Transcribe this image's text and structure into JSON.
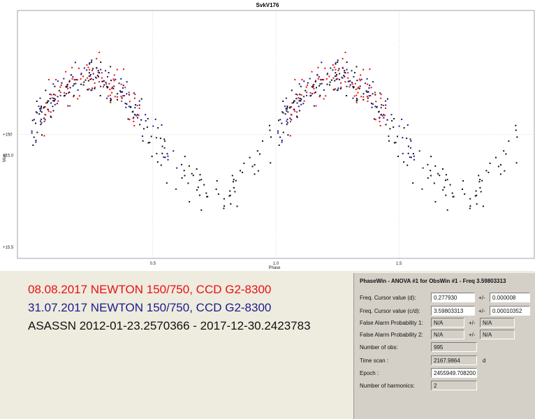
{
  "chart_data": {
    "type": "scatter",
    "title": "SvkV176",
    "xlabel": "Phase",
    "ylabel": "Mag",
    "xlim": [
      -0.05,
      2.05
    ],
    "ylim": [
      15.55,
      14.45
    ],
    "x_ticks": [
      "0.5",
      "1.0",
      "1.5"
    ],
    "x_tick_values": [
      0.5,
      1.0,
      1.5
    ],
    "y_ticks": [
      "+150",
      "+15.0",
      "+15.5"
    ],
    "y_tick_values": [
      15.0,
      15.0,
      15.5
    ],
    "grid": true,
    "curve": {
      "mean": 15.0,
      "amplitude": 0.26,
      "maximum_phase": 0.25
    },
    "series": [
      {
        "name": "08.08.2017 NEWTON 150/750, CCD G2-8300",
        "color": "#e8110f",
        "phase_range": [
          0.05,
          0.45
        ],
        "count": 95,
        "seed": 11
      },
      {
        "name": "31.07.2017 NEWTON 150/750, CCD G2-8300",
        "color": "#1b1b8a",
        "phase_range": [
          0.0,
          0.6
        ],
        "count": 105,
        "seed": 23
      },
      {
        "name": "ASASSN 2012-01-23.2570366 - 2017-12-30.2423783",
        "color": "#111111",
        "phase_range": [
          0.0,
          1.0
        ],
        "count": 150,
        "seed": 37
      }
    ]
  },
  "legend": {
    "red": "08.08.2017  NEWTON 150/750, CCD G2-8300",
    "blue": "31.07.2017  NEWTON 150/750, CCD G2-8300",
    "black": "ASASSN 2012-01-23.2570366 - 2017-12-30.2423783"
  },
  "phasewin": {
    "title": "PhaseWin - ANOVA #1 for ObsWin #1 - Freq 3.59803313",
    "plus_minus": "+/-",
    "freq_cursor_d": {
      "label": "Freq. Cursor value (d):",
      "value": "0.277930",
      "error": "0.000008"
    },
    "freq_cursor_cd": {
      "label": "Freq. Cursor value (c/d):",
      "value": "3.59803313",
      "error": "0.00010352"
    },
    "false_alarm_1": {
      "label": "False Alarm Probability 1:",
      "value": "N/A",
      "error": "N/A"
    },
    "false_alarm_2": {
      "label": "False Alarm Probability 2:",
      "value": "N/A",
      "error": "N/A"
    },
    "number_obs": {
      "label": "Number of obs:",
      "value": "995"
    },
    "time_scan": {
      "label": "Time scan :",
      "value": "2167.9864",
      "unit": "d"
    },
    "epoch": {
      "label": "Epoch :",
      "value": "2455949.708200"
    },
    "harmonics": {
      "label": "Number of harmonics:",
      "value": "2"
    }
  }
}
